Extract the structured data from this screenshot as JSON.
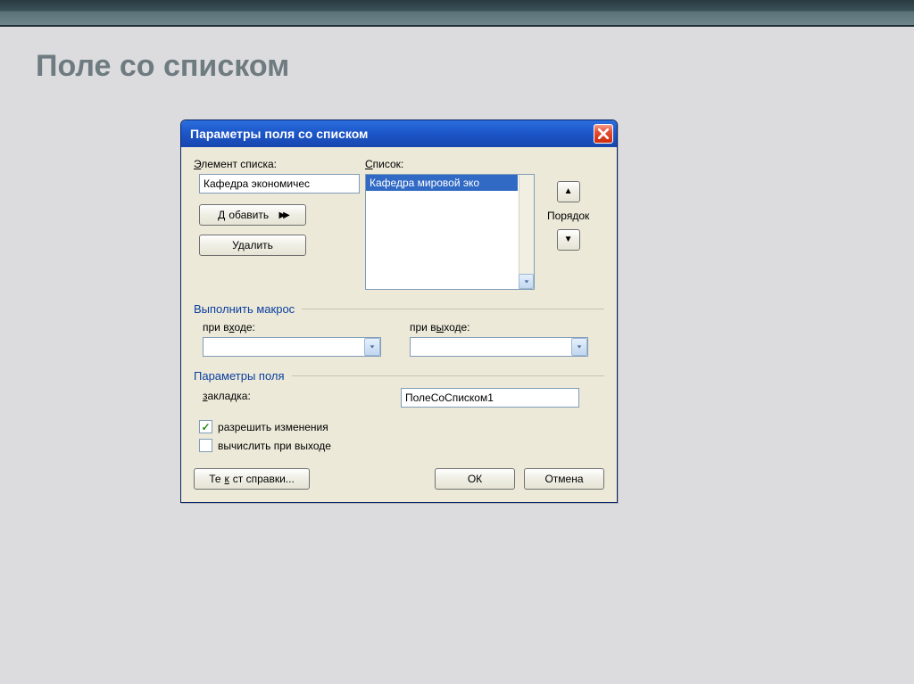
{
  "page": {
    "title": "Поле со списком"
  },
  "dialog": {
    "title": "Параметры поля со списком",
    "element_label": "Элемент списка:",
    "element_value": "Кафедра экономичес",
    "list_label": "Список:",
    "list_selected_item": "Кафедра мировой эко",
    "add_label": "Добавить",
    "delete_label": "Удалить",
    "order_label": "Порядок",
    "macro_group": "Выполнить макрос",
    "macro_on_entry_label": "при входе:",
    "macro_on_exit_label": "при выходе:",
    "macro_on_entry_value": "",
    "macro_on_exit_value": "",
    "params_group": "Параметры поля",
    "bookmark_label": "закладка:",
    "bookmark_value": "ПолеСоСписком1",
    "allow_changes_label": "разрешить изменения",
    "allow_changes_checked": true,
    "calc_on_exit_label": "вычислить при выходе",
    "calc_on_exit_checked": false,
    "help_text_label": "Текст справки...",
    "ok_label": "ОК",
    "cancel_label": "Отмена"
  }
}
